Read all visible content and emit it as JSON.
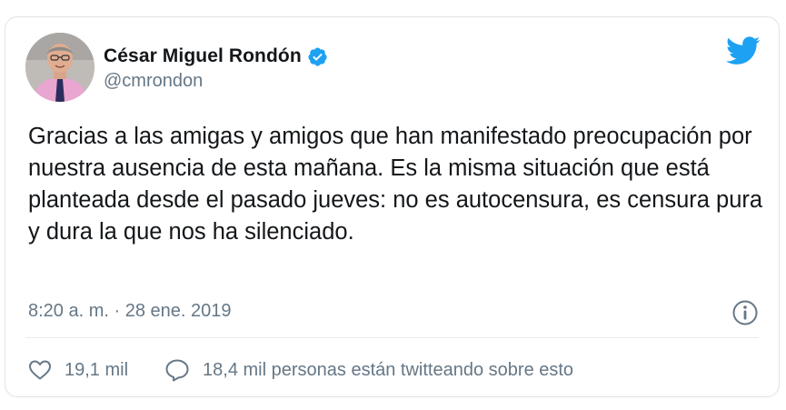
{
  "author": {
    "name": "César Miguel Rondón",
    "handle": "@cmrondon",
    "verified": true
  },
  "tweet": {
    "text": "Gracias a las amigas y amigos que han manifestado preocupación por nuestra ausencia de esta mañana. Es la misma situación que está planteada desde el pasado jueves: no es autocensura, es censura pura y dura la que nos ha silenciado.",
    "timestamp": "8:20 a. m. · 28 ene. 2019"
  },
  "actions": {
    "likes": "19,1 mil",
    "conversation": "18,4 mil personas están twitteando sobre esto"
  },
  "icons": {
    "brand": "twitter-bird-icon",
    "verified": "verified-badge-icon",
    "info": "info-icon",
    "like": "heart-icon",
    "reply": "speech-bubble-icon"
  },
  "colors": {
    "brand_blue": "#1da1f2",
    "text_primary": "#14171a",
    "text_secondary": "#657786",
    "border": "#dfe3e7"
  }
}
